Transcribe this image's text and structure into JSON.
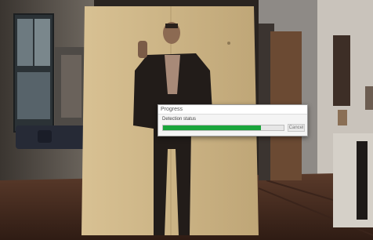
{
  "progress_dialog": {
    "title": "Progress",
    "status_text": "Detection status",
    "progress_fraction": 0.81,
    "cancel_label": "Cancel"
  },
  "colors": {
    "progress_fill": "#19a53b",
    "wall_panel": "#cdb58a",
    "floor": "#4a2e22"
  }
}
